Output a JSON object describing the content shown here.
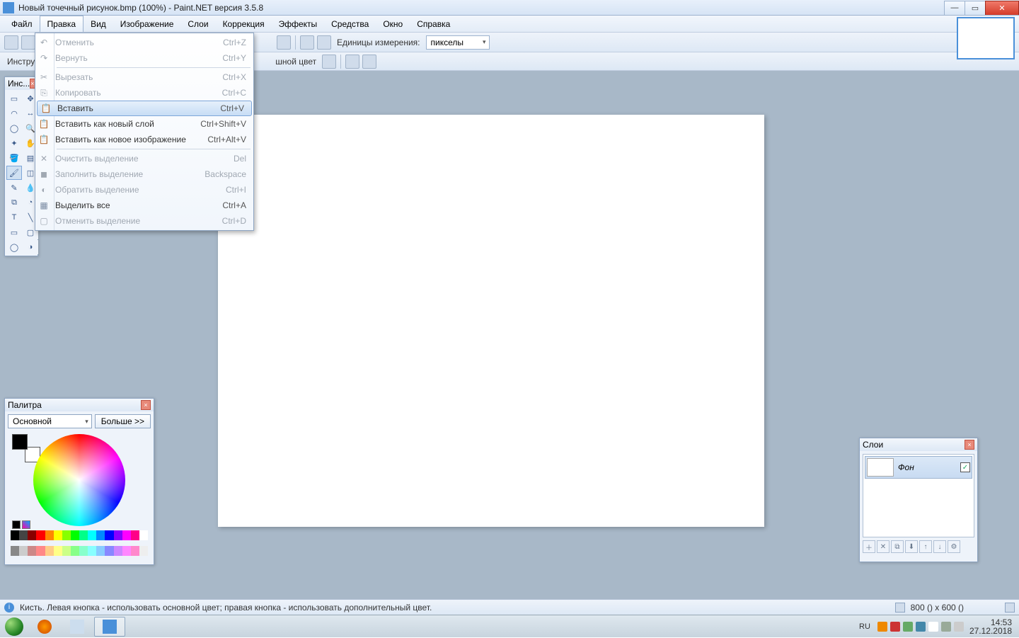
{
  "titlebar": {
    "title": "Новый точечный рисунок.bmp (100%) - Paint.NET версия 3.5.8"
  },
  "menu": {
    "file": "Файл",
    "edit": "Правка",
    "view": "Вид",
    "image": "Изображение",
    "layers": "Слои",
    "adjust": "Коррекция",
    "effects": "Эффекты",
    "tools": "Средства",
    "window": "Окно",
    "help": "Справка"
  },
  "toolbar": {
    "tool_label": "Инстру",
    "units_label": "Единицы измерения:",
    "units_value": "пикселы",
    "fill_label": "шной цвет"
  },
  "edit_menu": {
    "undo": {
      "label": "Отменить",
      "key": "Ctrl+Z"
    },
    "redo": {
      "label": "Вернуть",
      "key": "Ctrl+Y"
    },
    "cut": {
      "label": "Вырезать",
      "key": "Ctrl+X"
    },
    "copy": {
      "label": "Копировать",
      "key": "Ctrl+C"
    },
    "paste": {
      "label": "Вставить",
      "key": "Ctrl+V"
    },
    "paste_layer": {
      "label": "Вставить как новый слой",
      "key": "Ctrl+Shift+V"
    },
    "paste_image": {
      "label": "Вставить как новое изображение",
      "key": "Ctrl+Alt+V"
    },
    "clear_sel": {
      "label": "Очистить выделение",
      "key": "Del"
    },
    "fill_sel": {
      "label": "Заполнить выделение",
      "key": "Backspace"
    },
    "invert_sel": {
      "label": "Обратить выделение",
      "key": "Ctrl+I"
    },
    "select_all": {
      "label": "Выделить все",
      "key": "Ctrl+A"
    },
    "deselect": {
      "label": "Отменить выделение",
      "key": "Ctrl+D"
    }
  },
  "tools_panel": {
    "title": "Инс..."
  },
  "palette": {
    "title": "Палитра",
    "mode": "Основной",
    "more": "Больше >>"
  },
  "layers": {
    "title": "Слои",
    "layer0": "Фон"
  },
  "status": {
    "text": "Кисть. Левая кнопка - использовать основной цвет; правая кнопка - использовать дополнительный цвет.",
    "dims": "800 () x 600 ()"
  },
  "taskbar": {
    "lang": "RU",
    "time": "14:53",
    "date": "27.12.2018"
  }
}
